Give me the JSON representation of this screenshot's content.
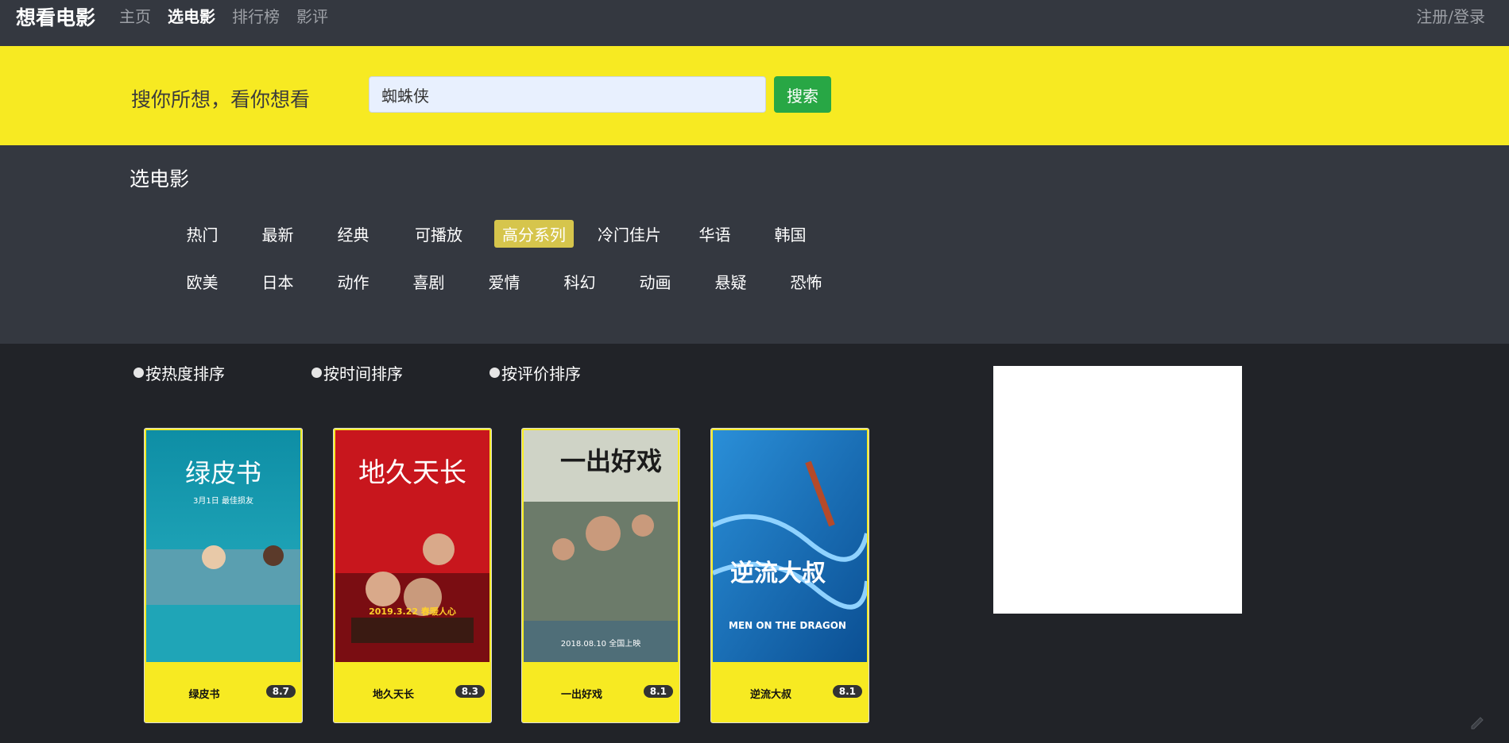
{
  "nav": {
    "brand": "想看电影",
    "links": [
      "主页",
      "选电影",
      "排行榜",
      "影评"
    ],
    "active": "选电影",
    "login": "注册/登录"
  },
  "banner": {
    "slogan": "搜你所想，看你想看",
    "search_value": "蜘蛛侠",
    "search_button": "搜索"
  },
  "categories": {
    "title": "选电影",
    "row1": [
      "热门",
      "最新",
      "经典",
      "可播放",
      "高分系列",
      "冷门佳片",
      "华语",
      "韩国"
    ],
    "row2": [
      "欧美",
      "日本",
      "动作",
      "喜剧",
      "爱情",
      "科幻",
      "动画",
      "悬疑",
      "恐怖"
    ],
    "selected": "高分系列"
  },
  "sort": {
    "options": [
      "按热度排序",
      "按时间排序",
      "按评价排序"
    ]
  },
  "movies": [
    {
      "title": "绿皮书",
      "score": "8.7",
      "poster_text": "绿皮书",
      "poster_sub": "3月1日 最佳损友",
      "poster_color": "#1a9fb0"
    },
    {
      "title": "地久天长",
      "score": "8.3",
      "poster_text": "地久天长",
      "poster_sub": "2019.3.22 春暖人心",
      "poster_color": "#c8161d"
    },
    {
      "title": "一出好戏",
      "score": "8.1",
      "poster_text": "一出好戏",
      "poster_sub": "2018.08.10 全国上映",
      "poster_color": "#7c8a7a"
    },
    {
      "title": "逆流大叔",
      "score": "8.1",
      "poster_text": "逆流大叔",
      "poster_sub": "MEN ON THE DRAGON",
      "poster_color": "#1f6fb8"
    }
  ],
  "colors": {
    "nav_bg": "#343840",
    "banner_bg": "#f7ea22",
    "body_bg": "#212328",
    "search_button": "#28a745",
    "selected_category": "#d6c54c"
  },
  "icons": {
    "corner": "pen-icon"
  }
}
